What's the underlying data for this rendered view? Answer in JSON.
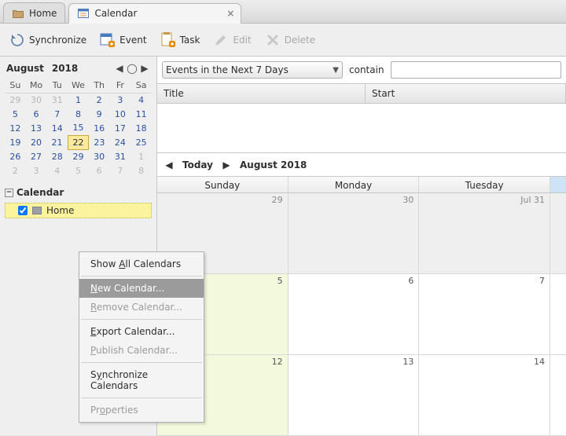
{
  "tabs": {
    "home": "Home",
    "calendar": "Calendar"
  },
  "toolbar": {
    "sync": "Synchronize",
    "event": "Event",
    "task": "Task",
    "edit": "Edit",
    "delete": "Delete"
  },
  "minical": {
    "month": "August",
    "year": "2018",
    "dow": [
      "Su",
      "Mo",
      "Tu",
      "We",
      "Th",
      "Fr",
      "Sa"
    ],
    "rows": [
      [
        {
          "n": "29",
          "cls": "other"
        },
        {
          "n": "30",
          "cls": "other"
        },
        {
          "n": "31",
          "cls": "other"
        },
        {
          "n": "1",
          "cls": "cur"
        },
        {
          "n": "2",
          "cls": "cur"
        },
        {
          "n": "3",
          "cls": "cur"
        },
        {
          "n": "4",
          "cls": "cur"
        }
      ],
      [
        {
          "n": "5",
          "cls": "cur"
        },
        {
          "n": "6",
          "cls": "cur"
        },
        {
          "n": "7",
          "cls": "cur"
        },
        {
          "n": "8",
          "cls": "cur"
        },
        {
          "n": "9",
          "cls": "cur"
        },
        {
          "n": "10",
          "cls": "cur"
        },
        {
          "n": "11",
          "cls": "cur"
        }
      ],
      [
        {
          "n": "12",
          "cls": "cur"
        },
        {
          "n": "13",
          "cls": "cur"
        },
        {
          "n": "14",
          "cls": "cur"
        },
        {
          "n": "15",
          "cls": "cur"
        },
        {
          "n": "16",
          "cls": "cur"
        },
        {
          "n": "17",
          "cls": "cur"
        },
        {
          "n": "18",
          "cls": "cur"
        }
      ],
      [
        {
          "n": "19",
          "cls": "cur"
        },
        {
          "n": "20",
          "cls": "cur"
        },
        {
          "n": "21",
          "cls": "cur"
        },
        {
          "n": "22",
          "cls": "today"
        },
        {
          "n": "23",
          "cls": "cur"
        },
        {
          "n": "24",
          "cls": "cur"
        },
        {
          "n": "25",
          "cls": "cur"
        }
      ],
      [
        {
          "n": "26",
          "cls": "cur"
        },
        {
          "n": "27",
          "cls": "cur"
        },
        {
          "n": "28",
          "cls": "cur"
        },
        {
          "n": "29",
          "cls": "cur"
        },
        {
          "n": "30",
          "cls": "cur"
        },
        {
          "n": "31",
          "cls": "cur"
        },
        {
          "n": "1",
          "cls": "other"
        }
      ],
      [
        {
          "n": "2",
          "cls": "other"
        },
        {
          "n": "3",
          "cls": "other"
        },
        {
          "n": "4",
          "cls": "other"
        },
        {
          "n": "5",
          "cls": "other"
        },
        {
          "n": "6",
          "cls": "other"
        },
        {
          "n": "7",
          "cls": "other"
        },
        {
          "n": "8",
          "cls": "other"
        }
      ]
    ]
  },
  "sections": {
    "calendar": "Calendar"
  },
  "calendars": {
    "home": "Home"
  },
  "filter": {
    "range_label": "Events in the Next 7 Days",
    "contain": "contain"
  },
  "eventlist": {
    "title": "Title",
    "start": "Start"
  },
  "nav": {
    "today": "Today",
    "month": "August 2018"
  },
  "weekhead": [
    "Sunday",
    "Monday",
    "Tuesday",
    ""
  ],
  "month_cells": {
    "r0": [
      "29",
      "30",
      "Jul 31"
    ],
    "r1": [
      "5",
      "6",
      "7"
    ],
    "r2": [
      "12",
      "13",
      "14"
    ]
  },
  "ctx": {
    "show_all": "Show All Calendars",
    "new": "New Calendar...",
    "remove": "Remove Calendar...",
    "export": "Export Calendar...",
    "publish": "Publish Calendar...",
    "sync": "Synchronize Calendars",
    "props": "Properties"
  }
}
